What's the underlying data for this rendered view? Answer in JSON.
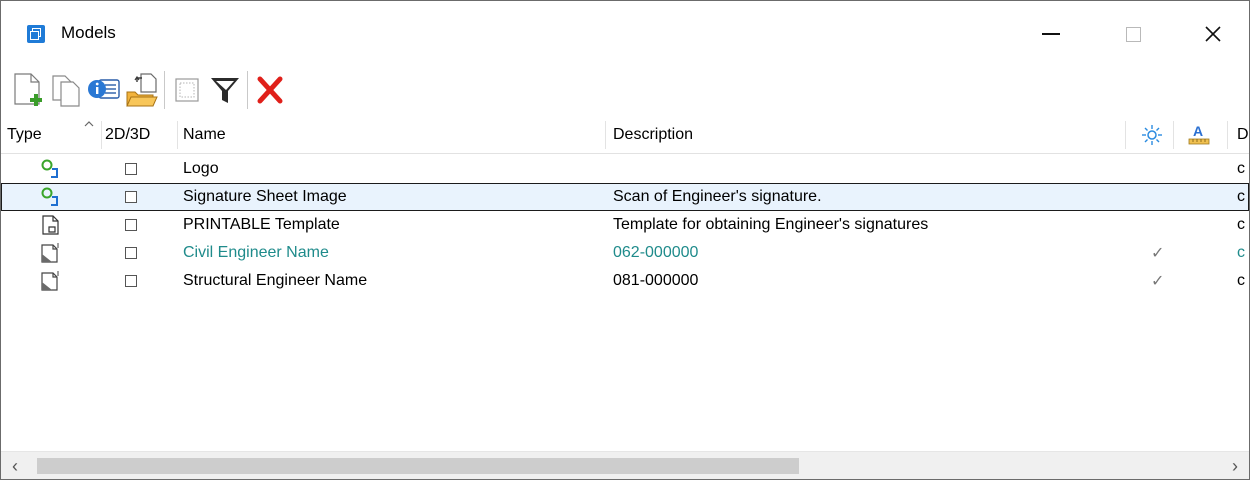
{
  "window": {
    "title": "Models",
    "controls": {
      "minimize": "minimize",
      "maximize": "maximize",
      "close": "close"
    }
  },
  "toolbar": {
    "buttons": [
      {
        "name": "new-model",
        "icon": "new-document-plus-icon"
      },
      {
        "name": "copy-model",
        "icon": "copy-pages-icon"
      },
      {
        "name": "model-properties",
        "icon": "info-card-icon"
      },
      {
        "name": "import-model",
        "icon": "folder-import-icon"
      },
      {
        "name": "select-all",
        "icon": "dotted-square-icon"
      },
      {
        "name": "filter",
        "icon": "funnel-icon"
      },
      {
        "name": "delete",
        "icon": "red-x-icon",
        "color": "#e0201a"
      }
    ]
  },
  "table": {
    "columns": {
      "type": "Type",
      "dim": "2D/3D",
      "name": "Name",
      "description": "Description",
      "display_icon": "sun-display-icon",
      "annotation_icon": "annotation-scale-icon",
      "overflow": "D"
    },
    "rows": [
      {
        "type_icon": "design-model-green-icon",
        "name": "Logo",
        "description": "",
        "check": "",
        "trail": "c",
        "color": "#000000",
        "selected": false
      },
      {
        "type_icon": "design-model-green-icon",
        "name": "Signature Sheet Image",
        "description": "Scan of Engineer's signature.",
        "check": "",
        "trail": "c",
        "color": "#000000",
        "selected": true
      },
      {
        "type_icon": "sheet-model-icon",
        "name": "PRINTABLE Template",
        "description": "Template for obtaining Engineer's signatures",
        "check": "",
        "trail": "c",
        "color": "#000000",
        "selected": false
      },
      {
        "type_icon": "drawing-model-icon",
        "name": "Civil Engineer Name",
        "description": "062-000000",
        "check": "✓",
        "trail": "c",
        "color": "#1f8b8b",
        "selected": false
      },
      {
        "type_icon": "drawing-model-icon",
        "name": "Structural Engineer Name",
        "description": "081-000000",
        "check": "✓",
        "trail": "c",
        "color": "#000000",
        "selected": false
      }
    ]
  },
  "scrollbar": {
    "left_arrow": "‹",
    "right_arrow": "›",
    "position": 0
  }
}
